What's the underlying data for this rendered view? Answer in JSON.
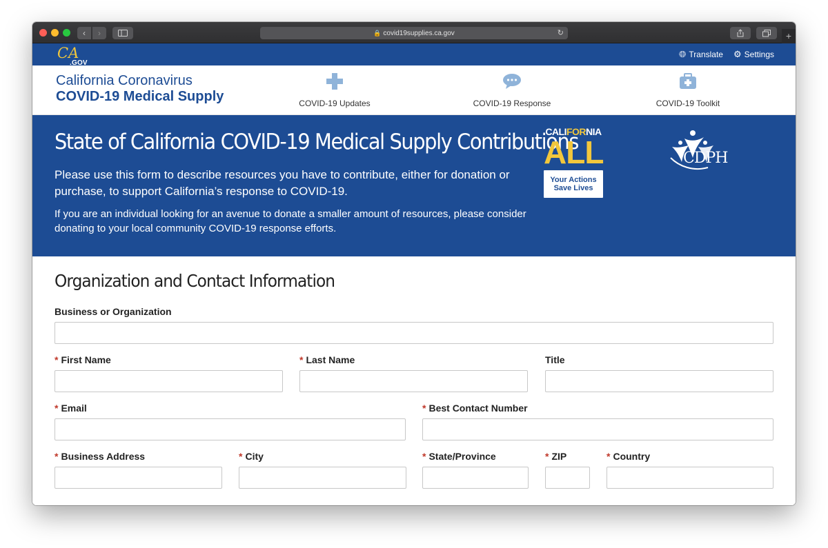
{
  "browser": {
    "url": "covid19supplies.ca.gov"
  },
  "utility": {
    "logo_text": "CA",
    "logo_sub": ".GOV",
    "translate": "Translate",
    "settings": "Settings"
  },
  "header": {
    "site_name_line1": "California Coronavirus",
    "site_name_line2": "COVID-19 Medical Supply",
    "nav": [
      {
        "label": "COVID-19 Updates",
        "icon": "plus-icon"
      },
      {
        "label": "COVID-19 Response",
        "icon": "speech-bubble-icon"
      },
      {
        "label": "COVID-19 Toolkit",
        "icon": "medical-kit-icon"
      }
    ]
  },
  "hero": {
    "title": "State of California COVID-19 Medical Supply Contributions",
    "paragraph1": "Please use this form to describe resources you have to contribute, either for donation or purchase, to support California’s response to COVID-19.",
    "paragraph2": "If you are an individual looking for an avenue to donate a smaller amount of resources, please consider donating to your local community COVID-19 response efforts.",
    "campaign": {
      "top_left": "CALI",
      "top_mid": "FOR",
      "top_right": "NIA",
      "big": "ALL",
      "box_line1": "Your Actions",
      "box_line2": "Save Lives"
    },
    "cdph_text": "CDPH"
  },
  "form": {
    "section_title": "Organization and Contact Information",
    "required_marker": "*",
    "fields": {
      "business": {
        "label": "Business or Organization",
        "value": ""
      },
      "first_name": {
        "label": "First Name",
        "value": ""
      },
      "last_name": {
        "label": "Last Name",
        "value": ""
      },
      "title": {
        "label": "Title",
        "value": ""
      },
      "email": {
        "label": "Email",
        "value": ""
      },
      "phone": {
        "label": "Best Contact Number",
        "value": ""
      },
      "address": {
        "label": "Business Address",
        "value": ""
      },
      "city": {
        "label": "City",
        "value": ""
      },
      "state": {
        "label": "State/Province",
        "value": ""
      },
      "zip": {
        "label": "ZIP",
        "value": ""
      },
      "country": {
        "label": "Country",
        "value": ""
      }
    }
  },
  "colors": {
    "brand_blue": "#1d4c94",
    "accent_gold": "#f2c73c",
    "nav_icon": "#8fb3d9",
    "required_red": "#c0392b"
  }
}
